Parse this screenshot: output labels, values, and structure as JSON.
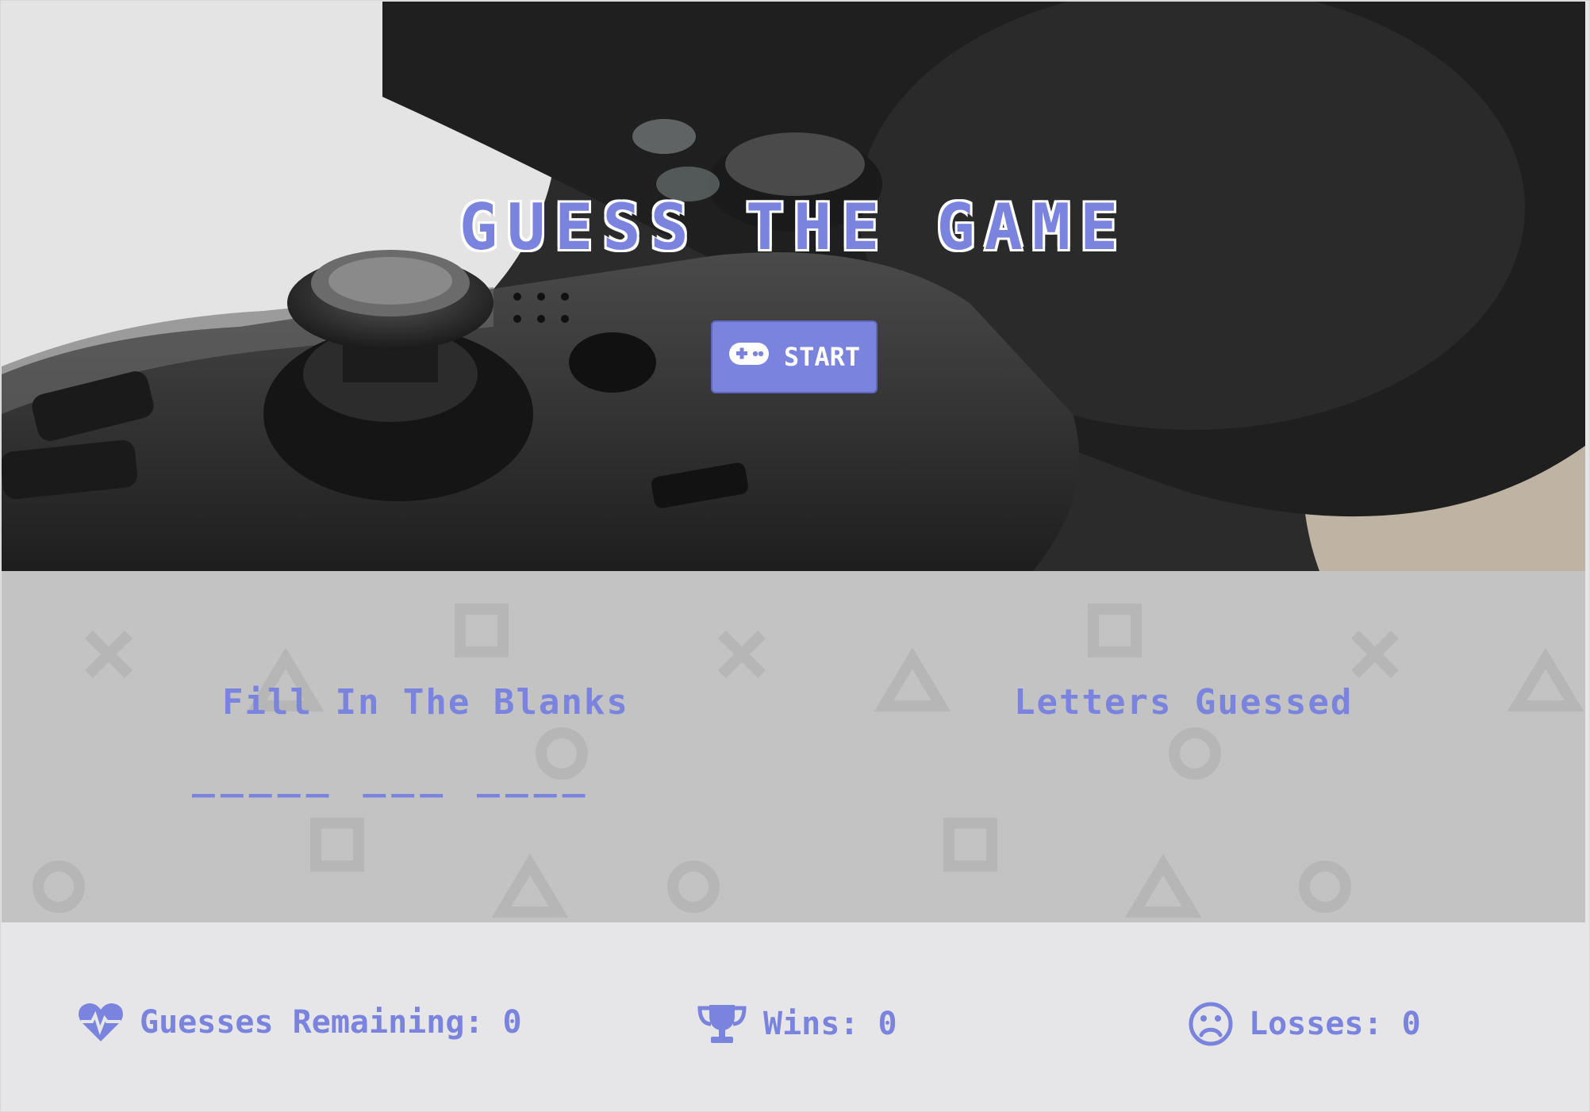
{
  "header": {
    "title": "GUESS THE GAME",
    "start_label": "START",
    "start_icon": "gamepad-icon"
  },
  "game": {
    "fill_heading": "Fill In The Blanks",
    "blanks": "_____ ___ ____",
    "letters_heading": "Letters Guessed",
    "letters_guessed": ""
  },
  "stats": {
    "guesses_label": "Guesses Remaining: 0",
    "wins_label": "Wins: 0",
    "losses_label": "Losses: 0",
    "guesses_icon": "heartbeat-icon",
    "wins_icon": "trophy-icon",
    "losses_icon": "frown-icon"
  },
  "colors": {
    "accent": "#7a83dd",
    "panel_bg": "#c3c3c3",
    "stats_bg": "#e6e6e8"
  }
}
